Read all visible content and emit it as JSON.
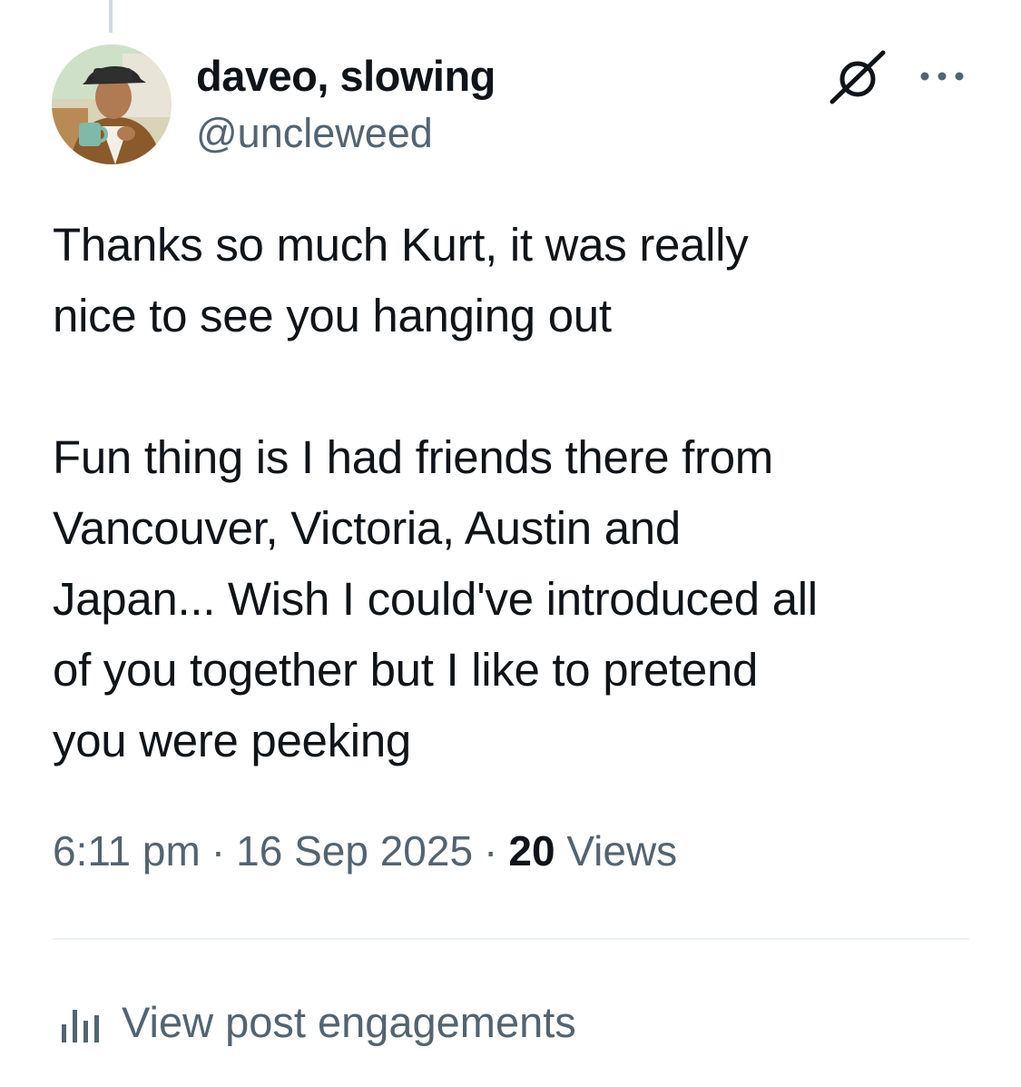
{
  "tweet": {
    "author": {
      "display_name": "daveo, slowing",
      "handle": "@uncleweed"
    },
    "text": "Thanks so much Kurt, it was really\nnice to see you hanging out\n\nFun thing is I had friends there from\nVancouver, Victoria, Austin and\nJapan... Wish I could've introduced all\nof you together but I like to pretend\nyou were peeking",
    "time": "6:11 pm",
    "date": "16 Sep 2025",
    "separator": "·",
    "views_count": "20",
    "views_label": "Views"
  },
  "actions": {
    "engagements_label": "View post engagements"
  },
  "icons": {
    "avatar": "avatar-photo",
    "grok": "grok-icon",
    "more": "more-icon",
    "engagements": "bar-chart-icon"
  },
  "colors": {
    "primary_text": "#0f1419",
    "secondary_text": "#536471",
    "divider": "#eff3f4",
    "thread_line": "#cfd9de"
  }
}
